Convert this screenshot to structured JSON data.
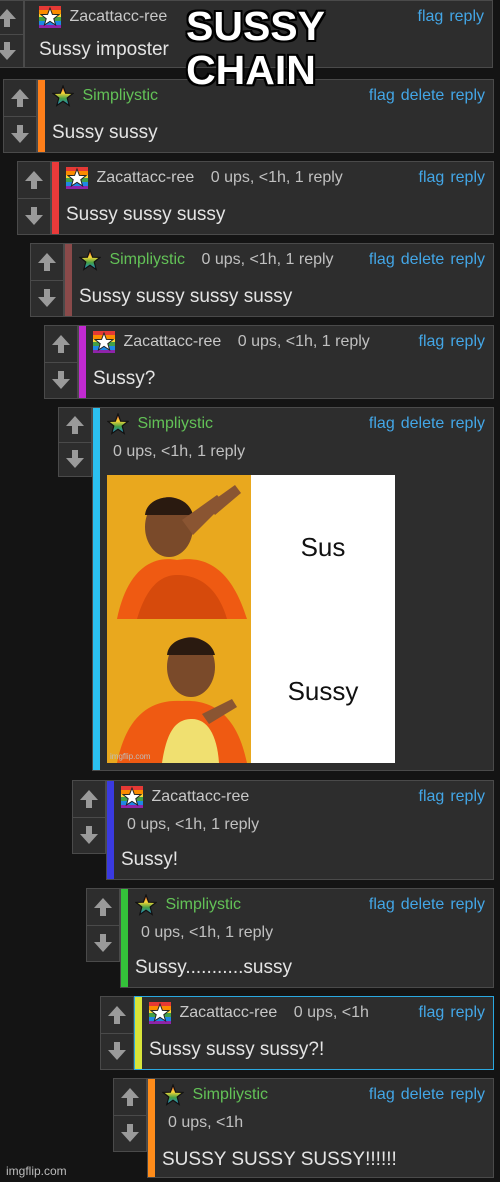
{
  "overlay": {
    "line1": "SUSSY",
    "line2": "CHAIN"
  },
  "actions": {
    "flag": "flag",
    "delete": "delete",
    "reply": "reply"
  },
  "colors": {
    "link": "#43a6e6",
    "user_green": "#63c257"
  },
  "comments": [
    {
      "user": "Zacattacc-ree",
      "meta": "",
      "text": "Sussy imposter",
      "own": false,
      "bar": ""
    },
    {
      "user": "Simpliystic",
      "meta": "",
      "text": "Sussy sussy",
      "own": true,
      "bar": "#ff7f1a"
    },
    {
      "user": "Zacattacc-ree",
      "meta": "0 ups, <1h, 1 reply",
      "text": "Sussy sussy sussy",
      "own": false,
      "bar": "#ea3a3a"
    },
    {
      "user": "Simpliystic",
      "meta": "0 ups, <1h, 1 reply",
      "text": "Sussy sussy sussy sussy",
      "own": true,
      "bar": "#8a4a4a"
    },
    {
      "user": "Zacattacc-ree",
      "meta": "0 ups, <1h, 1 reply",
      "text": "Sussy?",
      "own": false,
      "bar": "#c22ad1"
    },
    {
      "user": "Simpliystic",
      "meta": "0 ups, <1h, 1 reply",
      "text": "",
      "own": true,
      "bar": "#2bc0f0",
      "meme": {
        "top": "Sus",
        "bottom": "Sussy",
        "credit": "imgflip.com"
      }
    },
    {
      "user": "Zacattacc-ree",
      "meta": "0 ups, <1h, 1 reply",
      "text": "Sussy!",
      "own": false,
      "bar": "#3a3ae0"
    },
    {
      "user": "Simpliystic",
      "meta": "0 ups, <1h, 1 reply",
      "text": "Sussy...........sussy",
      "own": true,
      "bar": "#34c23a"
    },
    {
      "user": "Zacattacc-ree",
      "meta": "0 ups, <1h",
      "text": "Sussy sussy sussy?!",
      "own": false,
      "bar": "#d8e43a"
    },
    {
      "user": "Simpliystic",
      "meta": "0 ups, <1h",
      "text": "SUSSY SUSSY SUSSY!!!!!!",
      "own": true,
      "bar": "#ff8c1a"
    }
  ],
  "watermark": "imgflip.com"
}
